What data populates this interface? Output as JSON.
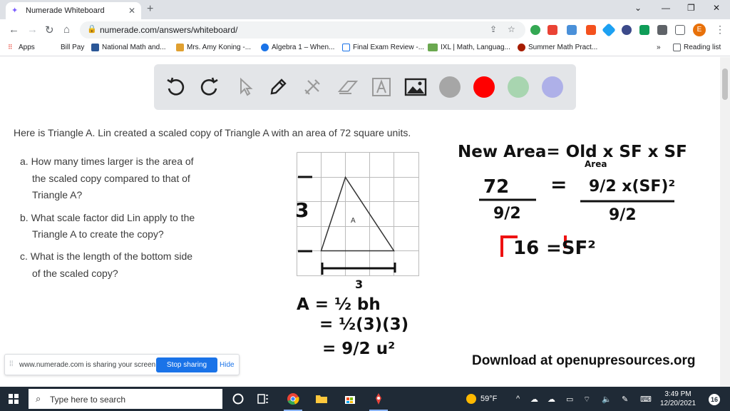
{
  "browser": {
    "tab_title": "Numerade Whiteboard",
    "url": "numerade.com/answers/whiteboard/",
    "profile_initial": "E",
    "bookmarks": [
      {
        "label": "Apps",
        "color": "#ea4335"
      },
      {
        "label": "Bill Pay",
        "color": "#ffffff"
      },
      {
        "label": "National Math and...",
        "color": "#2b5797"
      },
      {
        "label": "Mrs. Amy Koning -...",
        "color": "#e0a030"
      },
      {
        "label": "Algebra 1 – When...",
        "color": "#1a73e8"
      },
      {
        "label": "Final Exam Review -...",
        "color": "#1a73e8"
      },
      {
        "label": "IXL | Math, Languag...",
        "color": "#6aa84f"
      },
      {
        "label": "Summer Math Pract...",
        "color": "#a61c00"
      }
    ],
    "bookmarks_overflow": "»",
    "reading_list": "Reading list"
  },
  "whiteboard": {
    "tools": [
      "undo-icon",
      "redo-icon",
      "pointer-icon",
      "pen-icon",
      "tools-icon",
      "eraser-icon",
      "text-icon",
      "image-icon"
    ],
    "colors": [
      "#a6a6a6",
      "#ff0000",
      "#a8d5b0",
      "#aeb0e8"
    ]
  },
  "problem": {
    "intro": "Here is Triangle A. Lin created a scaled copy of Triangle A with an area of 72 square units.",
    "questions": [
      [
        "a. How many times larger is the area of",
        "the scaled copy compared to that of",
        "Triangle A?"
      ],
      [
        "b. What scale factor did Lin apply to the",
        "Triangle A to create the copy?"
      ],
      [
        "c. What is the length of the bottom side",
        "of the scaled copy?"
      ]
    ],
    "triangle_label": "A"
  },
  "handwriting": {
    "height_label": "3",
    "base_label": "3",
    "new_area": "New Area= Old x SF x SF",
    "area_word": "Area",
    "eq_left_num": "72",
    "eq_left_den": "9/2",
    "eq_equals": "=",
    "eq_right_top": "9/2 x(SF)²",
    "eq_right_den": "9/2",
    "root_line_left": "16",
    "root_line_right": "=SF²",
    "area_formula_1": "A = ½ bh",
    "area_formula_2": "= ½(3)(3)",
    "area_formula_3": "= 9/2 u²"
  },
  "footer_text": "Download at openupresources.org",
  "share_bar": {
    "message": "www.numerade.com is sharing your screen.",
    "stop_label": "Stop sharing",
    "hide_label": "Hide"
  },
  "taskbar": {
    "search_placeholder": "Type here to search",
    "temperature": "59°F",
    "time": "3:49 PM",
    "date": "12/20/2021",
    "notifications": "16"
  }
}
